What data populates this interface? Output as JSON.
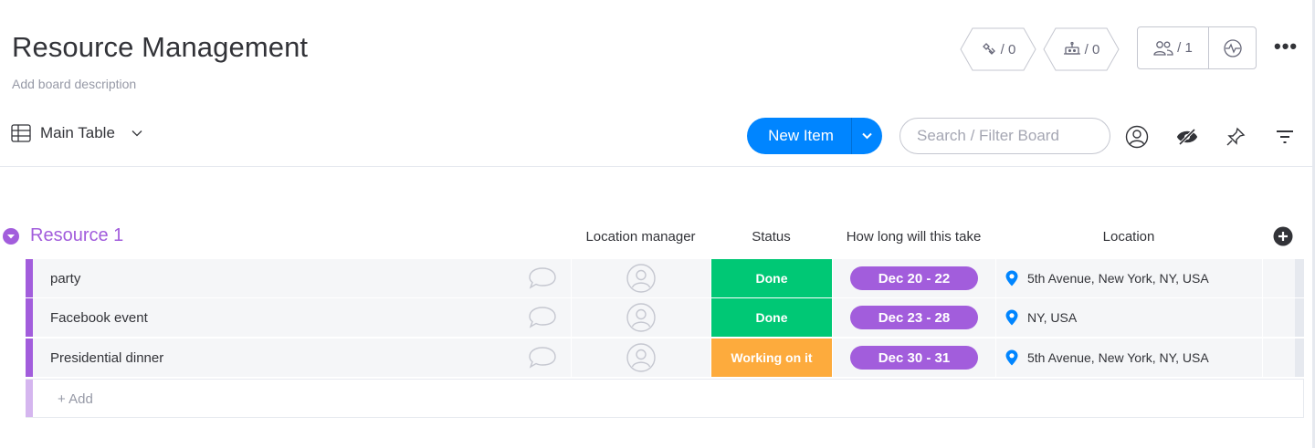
{
  "board": {
    "title": "Resource Management",
    "description": "Add board description",
    "integrations_count": "/ 0",
    "automations_count": "/ 0",
    "members_count": "/ 1"
  },
  "toolbar": {
    "view_label": "Main Table",
    "new_item_label": "New Item",
    "search_placeholder": "Search / Filter Board"
  },
  "group": {
    "title": "Resource 1",
    "color": "#a25ddc",
    "columns": {
      "location_manager": "Location manager",
      "status": "Status",
      "timeline": "How long will this take",
      "location": "Location"
    },
    "items": [
      {
        "name": "party",
        "status": "Done",
        "status_color": "#00c875",
        "timeline": "Dec 20 - 22",
        "location": "5th Avenue, New York, NY, USA"
      },
      {
        "name": "Facebook event",
        "status": "Done",
        "status_color": "#00c875",
        "timeline": "Dec 23 - 28",
        "location": "NY, USA"
      },
      {
        "name": "Presidential dinner",
        "status": "Working on it",
        "status_color": "#fdab3d",
        "timeline": "Dec 30 - 31",
        "location": "5th Avenue, New York, NY, USA"
      }
    ],
    "add_label": "+ Add"
  },
  "colors": {
    "primary": "#0085ff",
    "group_purple": "#a25ddc",
    "done_green": "#00c875",
    "working_orange": "#fdab3d",
    "location_pin": "#0085ff"
  }
}
